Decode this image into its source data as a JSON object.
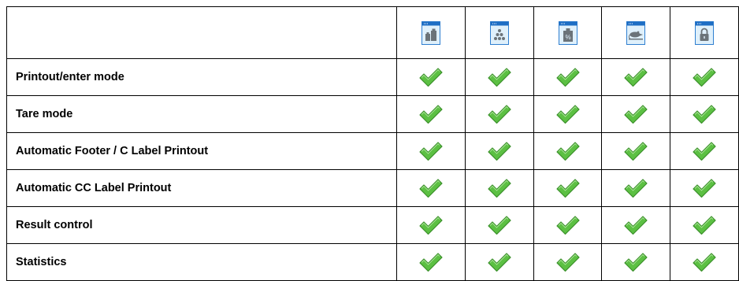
{
  "header": {
    "icons": [
      {
        "name": "checkweighing-weights-icon"
      },
      {
        "name": "counting-pieces-icon"
      },
      {
        "name": "percent-weighing-icon"
      },
      {
        "name": "animal-weighing-icon"
      },
      {
        "name": "lock-icon"
      }
    ]
  },
  "rows": [
    {
      "label": "Printout/enter mode",
      "checks": [
        true,
        true,
        true,
        true,
        true
      ]
    },
    {
      "label": "Tare mode",
      "checks": [
        true,
        true,
        true,
        true,
        true
      ]
    },
    {
      "label": "Automatic Footer / C Label Printout",
      "checks": [
        true,
        true,
        true,
        true,
        true
      ]
    },
    {
      "label": "Automatic CC Label Printout",
      "checks": [
        true,
        true,
        true,
        true,
        true
      ]
    },
    {
      "label": "Result control",
      "checks": [
        true,
        true,
        true,
        true,
        true
      ]
    },
    {
      "label": "Statistics",
      "checks": [
        true,
        true,
        true,
        true,
        true
      ]
    }
  ],
  "colors": {
    "icon_frame": "#2f7fd0",
    "icon_header": "#1e6ec4",
    "icon_body": "#dff0fb",
    "icon_glyph": "#6b7379",
    "check_fill": "#5cc043",
    "check_stroke": "#3a8f2a"
  }
}
